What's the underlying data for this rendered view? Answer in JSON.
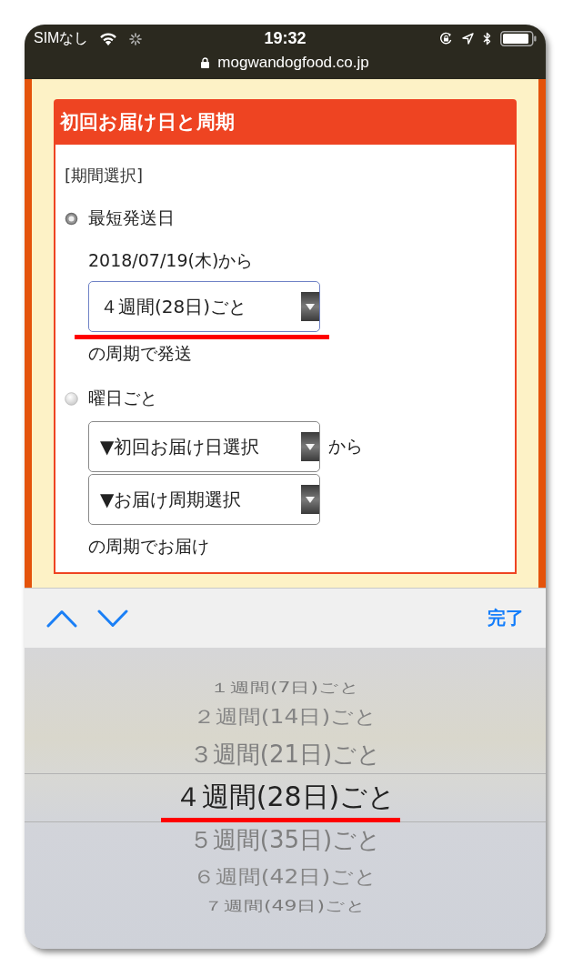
{
  "status_bar": {
    "carrier": "SIMなし",
    "time": "19:32"
  },
  "address_bar": {
    "url": "mogwandogfood.co.jp"
  },
  "section": {
    "title": "初回お届け日と周期",
    "label": "[期間選択]",
    "options": [
      {
        "label": "最短発送日",
        "selected": true,
        "content": [
          {
            "kind": "text",
            "text": "2018/07/19(木)から"
          },
          {
            "kind": "select",
            "value": "４週間(28日)ごと",
            "focused": true,
            "highlighted": true
          },
          {
            "kind": "text",
            "text": "の周期で発送"
          }
        ]
      },
      {
        "label": "曜日ごと",
        "selected": false,
        "content": [
          {
            "kind": "select",
            "value": "▼初回お届け日選択",
            "focused": false,
            "highlighted": false,
            "after": "から"
          },
          {
            "kind": "select",
            "value": "▼お届け周期選択",
            "focused": false,
            "highlighted": false
          },
          {
            "kind": "text",
            "text": "の周期でお届け"
          }
        ]
      }
    ]
  },
  "keyboard_toolbar": {
    "done": "完了"
  },
  "picker": {
    "items": [
      {
        "label": "１週間(7日)ごと",
        "selected": false,
        "highlighted": false
      },
      {
        "label": "２週間(14日)ごと",
        "selected": false,
        "highlighted": false
      },
      {
        "label": "３週間(21日)ごと",
        "selected": false,
        "highlighted": false
      },
      {
        "label": "４週間(28日)ごと",
        "selected": true,
        "highlighted": true
      },
      {
        "label": "５週間(35日)ごと",
        "selected": false,
        "highlighted": false
      },
      {
        "label": "６週間(42日)ごと",
        "selected": false,
        "highlighted": false
      },
      {
        "label": "７週間(49日)ごと",
        "selected": false,
        "highlighted": false
      }
    ]
  }
}
